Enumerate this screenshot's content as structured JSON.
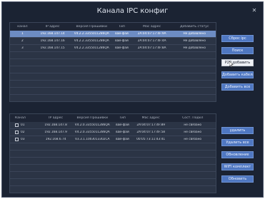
{
  "window": {
    "title": "Канала IPC конфиг",
    "close_icon": "close-icon"
  },
  "top_table": {
    "headers": [
      "канал",
      "IP адрес",
      "Версия Прошивки",
      "Тип",
      "Mac адрес",
      "Добавить статус"
    ],
    "rows": [
      [
        "1",
        "192.168.147.14",
        "V4.2.2.3355011286QA",
        "вай-фай",
        "2A:04:07:17:4F:9A",
        "Не добавлено"
      ],
      [
        "2",
        "192.168.147.16",
        "V4.2.2.3355011286QA",
        "вай-фай",
        "2A:04:07:17:4F:4A",
        "Не добавлено"
      ],
      [
        "3",
        "192.168.147.15",
        "V4.2.2.3355011286QA",
        "вай-фай",
        "2A:04:07:17:4F:8A",
        "Не добавлено"
      ]
    ],
    "selected_row": 0
  },
  "bottom_table": {
    "headers": [
      "Канал",
      "IP адрес",
      "Версия Прошивки",
      "Тип",
      "Mac адрес",
      "Сост. Подкл"
    ],
    "rows": [
      [
        "01",
        "192.168.147.8",
        "V4.2.0.3355011286QA",
        "вай-фай",
        "2A:04:07:17:4F:89",
        "не связано"
      ],
      [
        "02",
        "192.168.147.9",
        "V4.2.0.3355011286QA",
        "вай-фай",
        "2A:04:07:17:4F:58",
        "не связано"
      ],
      [
        "03",
        "192.168.6.74",
        "V3.3.1.1003013302CA",
        "вай-фай",
        "00:05:73:11:43:41",
        "не связано"
      ]
    ]
  },
  "top_buttons": [
    {
      "label": "Сброс ipc",
      "style": "blue"
    },
    {
      "label": "Поиск",
      "style": "blue"
    },
    {
      "label": "Р2Р добавить",
      "style": "white"
    },
    {
      "label": "Добавить кабель",
      "style": "blue"
    },
    {
      "label": "Добавить все",
      "style": "blue"
    }
  ],
  "bottom_buttons": [
    {
      "label": "удалить",
      "style": "blue"
    },
    {
      "label": "Удалить все",
      "style": "blue"
    },
    {
      "label": "Обновление",
      "style": "blue"
    },
    {
      "label": "WIFI комплект",
      "style": "blue"
    },
    {
      "label": "Обновить",
      "style": "blue"
    }
  ],
  "colors": {
    "background": "#1b2333",
    "panel": "#2b3445",
    "selected_row": "#6d8cc3",
    "button": "#4f77c1"
  }
}
